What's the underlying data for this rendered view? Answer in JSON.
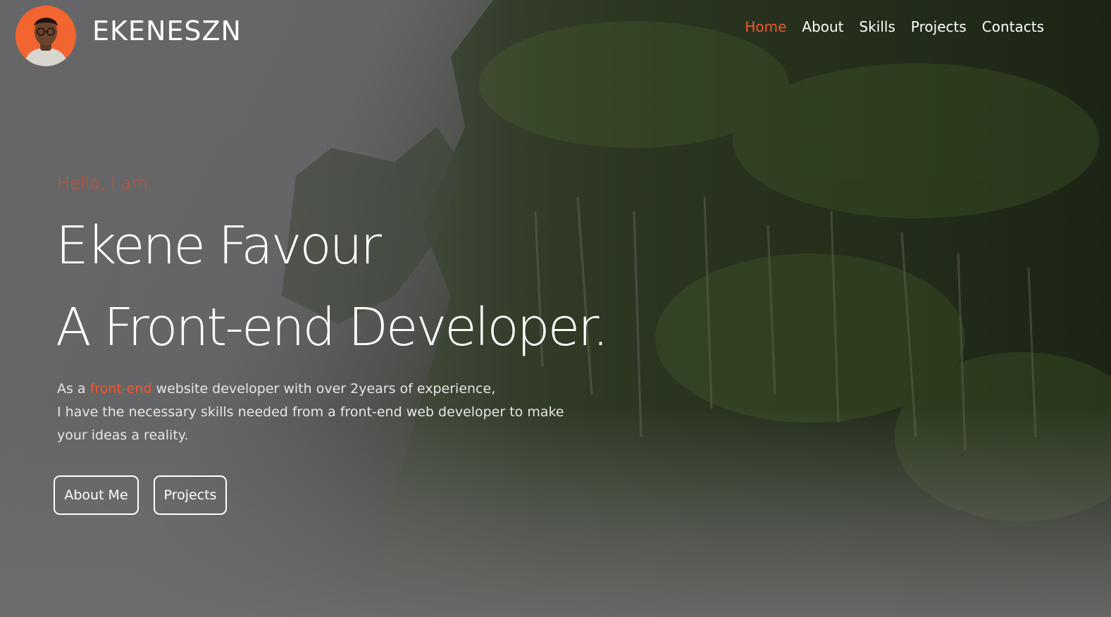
{
  "header": {
    "brand": "EKENESZN",
    "nav": [
      {
        "label": "Home",
        "active": true
      },
      {
        "label": "About",
        "active": false
      },
      {
        "label": "Skills",
        "active": false
      },
      {
        "label": "Projects",
        "active": false
      },
      {
        "label": "Contacts",
        "active": false
      }
    ]
  },
  "hero": {
    "greeting": "Hello, I am",
    "name": "Ekene Favour",
    "role": "A Front-end Developer.",
    "intro": {
      "prefix": "As a ",
      "highlight": "front-end",
      "line1_rest": " website developer with over 2years of experience,",
      "line2": "I have the necessary skills needed from a front-end web developer to make",
      "line3": "your ideas a reality."
    },
    "buttons": {
      "about": "About Me",
      "projects": "Projects"
    }
  },
  "colors": {
    "accent": "#f2562d",
    "avatar_bg": "#f26430",
    "text": "#ffffff"
  },
  "icons": {
    "avatar": "profile-avatar"
  }
}
